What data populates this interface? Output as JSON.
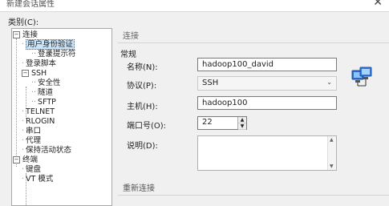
{
  "window": {
    "title": "新建会话属性"
  },
  "category_label": "类别(C):",
  "tree": [
    {
      "label": "连接",
      "toggle": "−"
    },
    {
      "label": "用户身份验证",
      "selected": true
    },
    {
      "label": "登录提示符"
    },
    {
      "label": "登录脚本"
    },
    {
      "label": "SSH",
      "toggle": "−"
    },
    {
      "label": "安全性"
    },
    {
      "label": "隧道"
    },
    {
      "label": "SFTP"
    },
    {
      "label": "TELNET"
    },
    {
      "label": "RLOGIN"
    },
    {
      "label": "串口"
    },
    {
      "label": "代理"
    },
    {
      "label": "保持活动状态"
    },
    {
      "label": "终端",
      "toggle": "−"
    },
    {
      "label": "键盘"
    },
    {
      "label": "VT 模式"
    }
  ],
  "section_title": "连接",
  "group_title": "常规",
  "fields": {
    "name": {
      "label": "名称(N):",
      "value": "hadoop100_david"
    },
    "protocol": {
      "label": "协议(P):",
      "value": "SSH"
    },
    "host": {
      "label": "主机(H):",
      "value": "hadoop100"
    },
    "port": {
      "label": "端口号(O):",
      "value": "22"
    },
    "description": {
      "label": "说明(D):",
      "value": ""
    }
  },
  "bottom_section_title": "重新连接",
  "icons": {
    "network": "network-computers-icon",
    "cursor": "hand-pointer-icon",
    "close": "close-icon"
  }
}
